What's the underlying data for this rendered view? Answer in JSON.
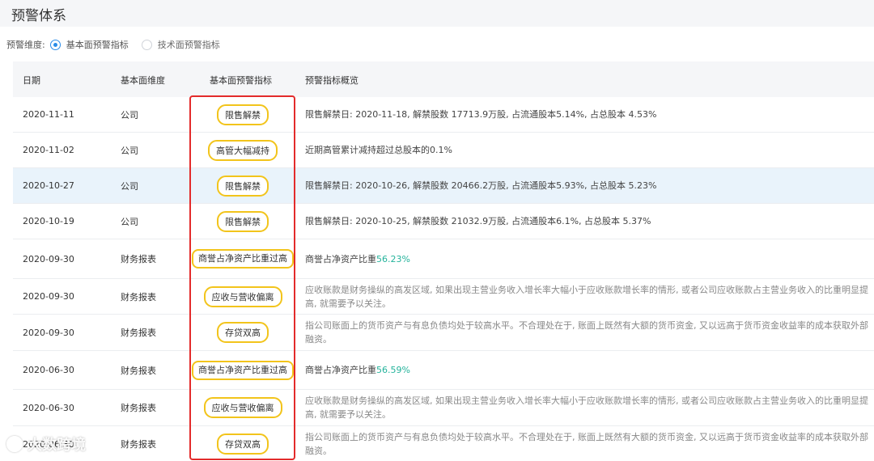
{
  "header": {
    "title": "预警体系"
  },
  "dimension": {
    "label": "预警维度:",
    "options": [
      {
        "label": "基本面预警指标",
        "checked": true
      },
      {
        "label": "技术面预警指标",
        "checked": false
      }
    ]
  },
  "table": {
    "columns": [
      "日期",
      "基本面维度",
      "基本面预警指标",
      "预警指标概览"
    ],
    "rows": [
      {
        "date": "2020-11-11",
        "dimension": "公司",
        "indicator": "限售解禁",
        "summary": "限售解禁日: 2020-11-18, 解禁股数 17713.9万股, 占流通股本5.14%, 占总股本 4.53%"
      },
      {
        "date": "2020-11-02",
        "dimension": "公司",
        "indicator": "高管大幅减持",
        "summary": "近期高管累计减持超过总股本的0.1%"
      },
      {
        "date": "2020-10-27",
        "dimension": "公司",
        "indicator": "限售解禁",
        "summary": "限售解禁日: 2020-10-26, 解禁股数 20466.2万股, 占流通股本5.93%, 占总股本 5.23%",
        "highlighted": true
      },
      {
        "date": "2020-10-19",
        "dimension": "公司",
        "indicator": "限售解禁",
        "summary": "限售解禁日: 2020-10-25, 解禁股数 21032.9万股, 占流通股本6.1%, 占总股本 5.37%"
      },
      {
        "date": "2020-09-30",
        "dimension": "财务报表",
        "indicator": "商誉占净资产比重过高",
        "summary_prefix": "商誉占净资产比重",
        "summary_value": "56.23%"
      },
      {
        "date": "2020-09-30",
        "dimension": "财务报表",
        "indicator": "应收与营收偏离",
        "summary": "应收账款是财务操纵的高发区域, 如果出现主营业务收入增长率大幅小于应收账款增长率的情形, 或者公司应收账款占主营业务收入的比重明显提高, 就需要予以关注。"
      },
      {
        "date": "2020-09-30",
        "dimension": "财务报表",
        "indicator": "存贷双高",
        "summary": "指公司账面上的货币资产与有息负债均处于较高水平。不合理处在于, 账面上既然有大额的货币资金, 又以远高于货币资金收益率的成本获取外部融资。"
      },
      {
        "date": "2020-06-30",
        "dimension": "财务报表",
        "indicator": "商誉占净资产比重过高",
        "summary_prefix": "商誉占净资产比重",
        "summary_value": "56.59%"
      },
      {
        "date": "2020-06-30",
        "dimension": "财务报表",
        "indicator": "应收与营收偏离",
        "summary": "应收账款是财务操纵的高发区域, 如果出现主营业务收入增长率大幅小于应收账款增长率的情形, 或者公司应收账款占主营业务收入的比重明显提高, 就需要予以关注。"
      },
      {
        "date": "2020-06-30",
        "dimension": "财务报表",
        "indicator": "存贷双高",
        "summary": "指公司账面上的货币资产与有息负债均处于较高水平。不合理处在于, 账面上既然有大额的货币资金, 又以远高于货币资金收益率的成本获取外部融资。"
      }
    ]
  },
  "watermark": {
    "text": "大数跨境"
  },
  "colors": {
    "accent": "#2a8ce8",
    "tag_border": "#f2c41b",
    "annotation_box": "#e32b2b",
    "positive_value": "#24b39b",
    "highlight_row": "#e9f3fb"
  }
}
